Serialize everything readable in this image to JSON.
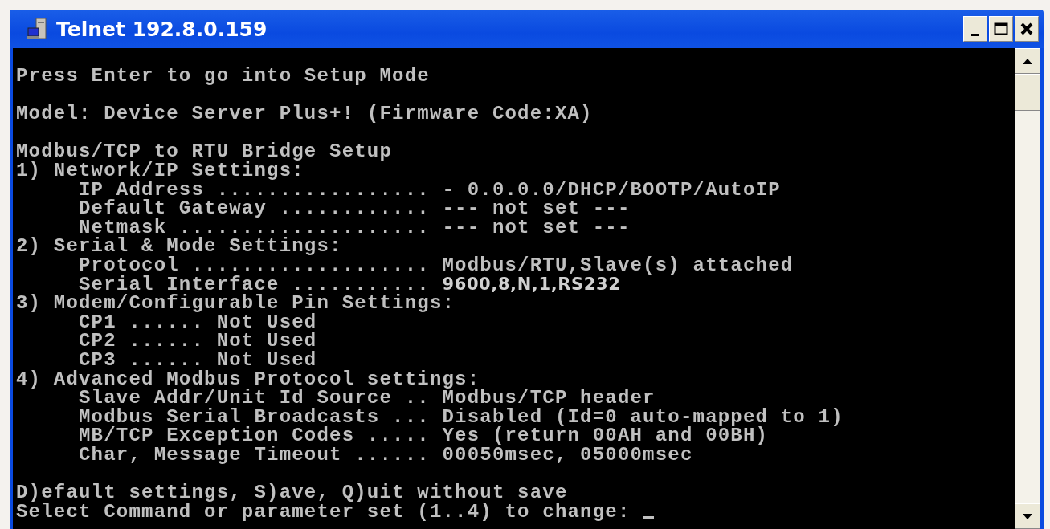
{
  "window": {
    "title": "Telnet 192.8.0.159"
  },
  "console": {
    "blocks": [
      [
        {
          "text": "Press Enter to go into Setup Mode"
        }
      ],
      [
        {
          "text": "Model: Device Server Plus+! (Firmware Code:XA)"
        }
      ],
      [
        {
          "text": "Modbus/TCP to RTU Bridge Setup"
        },
        {
          "text": "1) Network/IP Settings:"
        },
        {
          "text": "     IP Address ................. - 0.0.0.0/DHCP/BOOTP/AutoIP"
        },
        {
          "text": "     Default Gateway ............ --- not set ---"
        },
        {
          "text": "     Netmask .................... --- not set ---"
        },
        {
          "text": "2) Serial & Mode Settings:"
        },
        {
          "text": "     Protocol ................... Modbus/RTU,Slave(s) attached"
        },
        {
          "text": "     Serial Interface ........... ",
          "value": "9600,8,N,1,RS232"
        },
        {
          "text": "3) Modem/Configurable Pin Settings:"
        },
        {
          "text": "     CP1 ...... Not Used"
        },
        {
          "text": "     CP2 ...... Not Used"
        },
        {
          "text": "     CP3 ...... Not Used"
        },
        {
          "text": "4) Advanced Modbus Protocol settings:"
        },
        {
          "text": "     Slave Addr/Unit Id Source .. Modbus/TCP header"
        },
        {
          "text": "     Modbus Serial Broadcasts ... Disabled (Id=0 auto-mapped to 1)"
        },
        {
          "text": "     MB/TCP Exception Codes ..... Yes (return 00AH and 00BH)"
        },
        {
          "text": "     Char, Message Timeout ...... 00050msec, 05000msec"
        }
      ],
      [
        {
          "text": "D)efault settings, S)ave, Q)uit without save"
        },
        {
          "text": "Select Command or parameter set (1..4) to change: "
        }
      ]
    ]
  }
}
